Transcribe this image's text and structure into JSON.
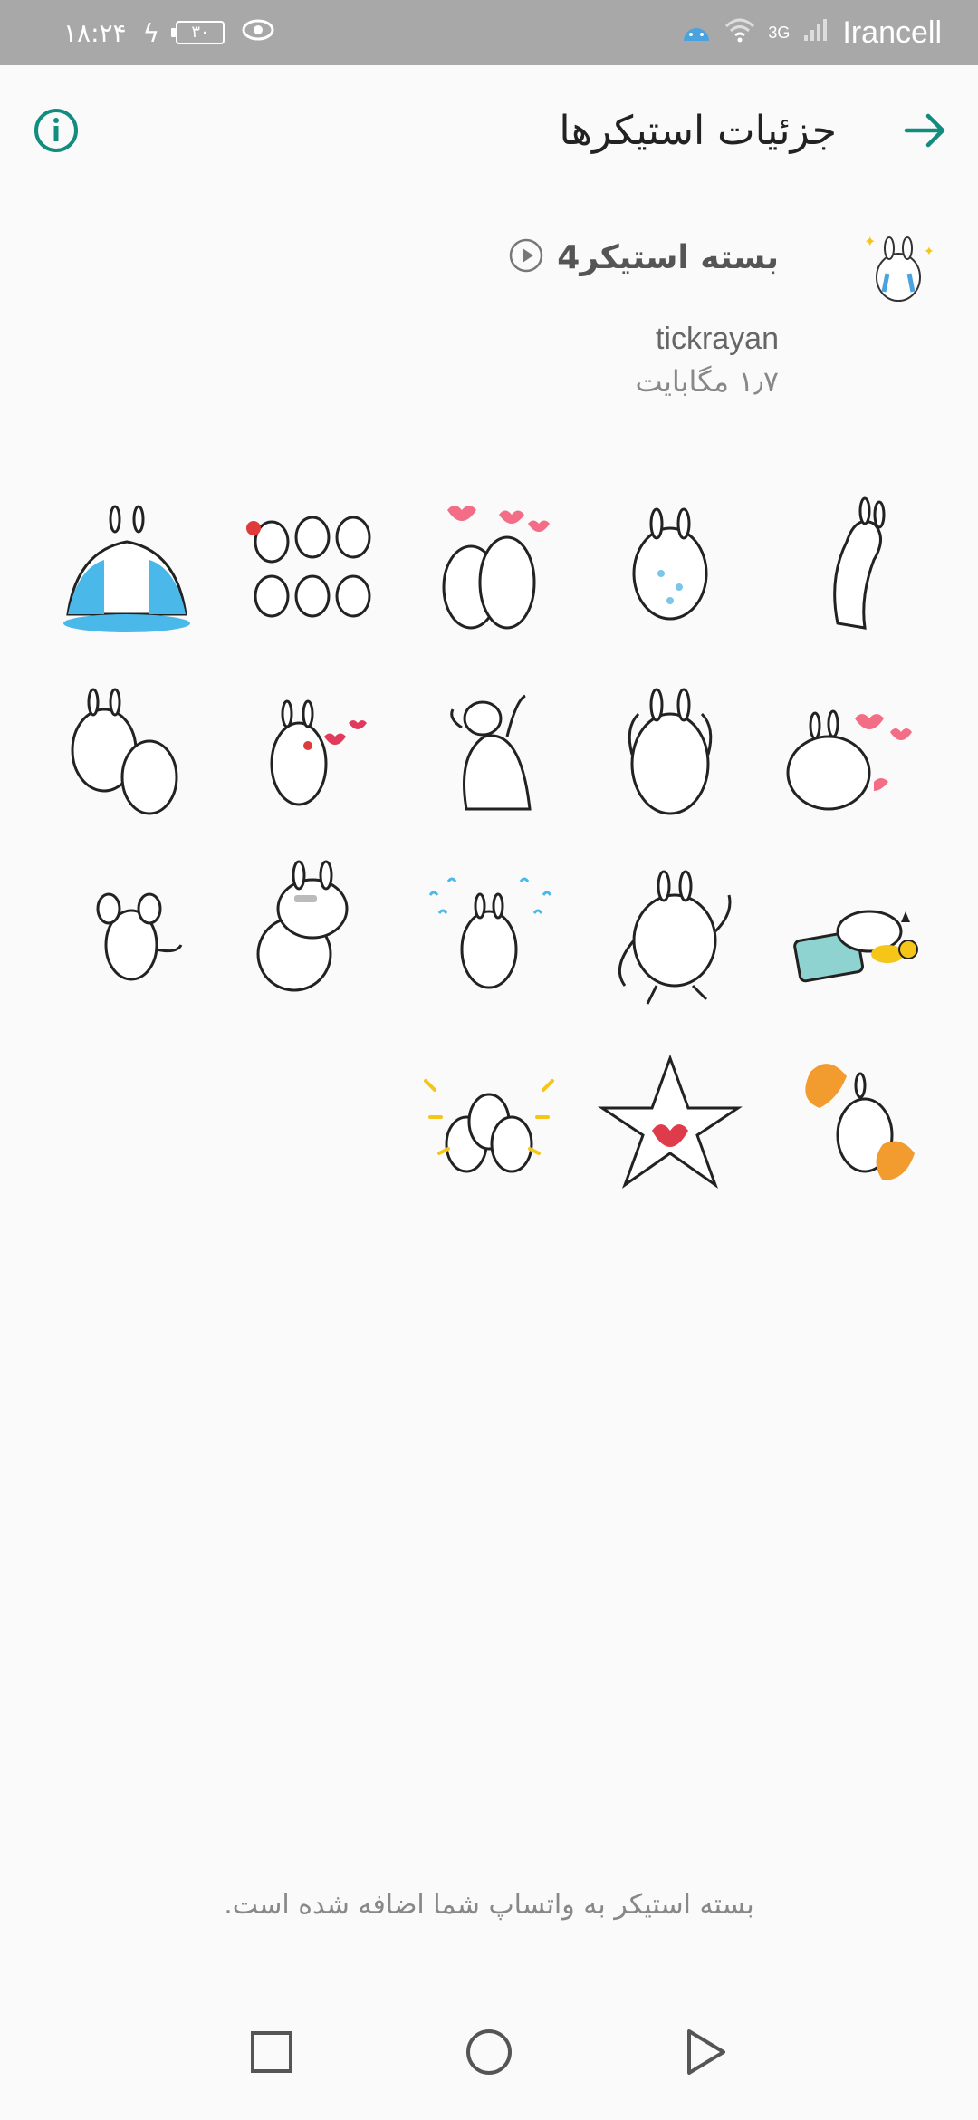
{
  "status_bar": {
    "time": "۱۸:۲۴",
    "battery": "۳۰",
    "network_type": "3G",
    "carrier": "Irancell"
  },
  "header": {
    "title": "جزئیات استیکرها"
  },
  "pack": {
    "name": "بسته استیکر4",
    "publisher": "tickrayan",
    "size": "۱٫۷ مگابایت"
  },
  "stickers": [
    "sticker-1",
    "sticker-2",
    "sticker-3",
    "sticker-4",
    "sticker-5",
    "sticker-6",
    "sticker-7",
    "sticker-8",
    "sticker-9",
    "sticker-10",
    "sticker-11",
    "sticker-12",
    "sticker-13",
    "sticker-14",
    "sticker-15",
    "sticker-16",
    "sticker-17",
    "sticker-18"
  ],
  "footer": {
    "message": "بسته استیکر به واتساپ شما اضافه شده است."
  },
  "colors": {
    "accent": "#128C7E",
    "status_bar": "#a8a8a8",
    "background": "#fafafa"
  },
  "icons": {
    "back": "arrow-right-icon",
    "info": "info-icon",
    "play": "play-icon",
    "nav_recents": "square-icon",
    "nav_home": "circle-icon",
    "nav_back": "triangle-icon"
  }
}
